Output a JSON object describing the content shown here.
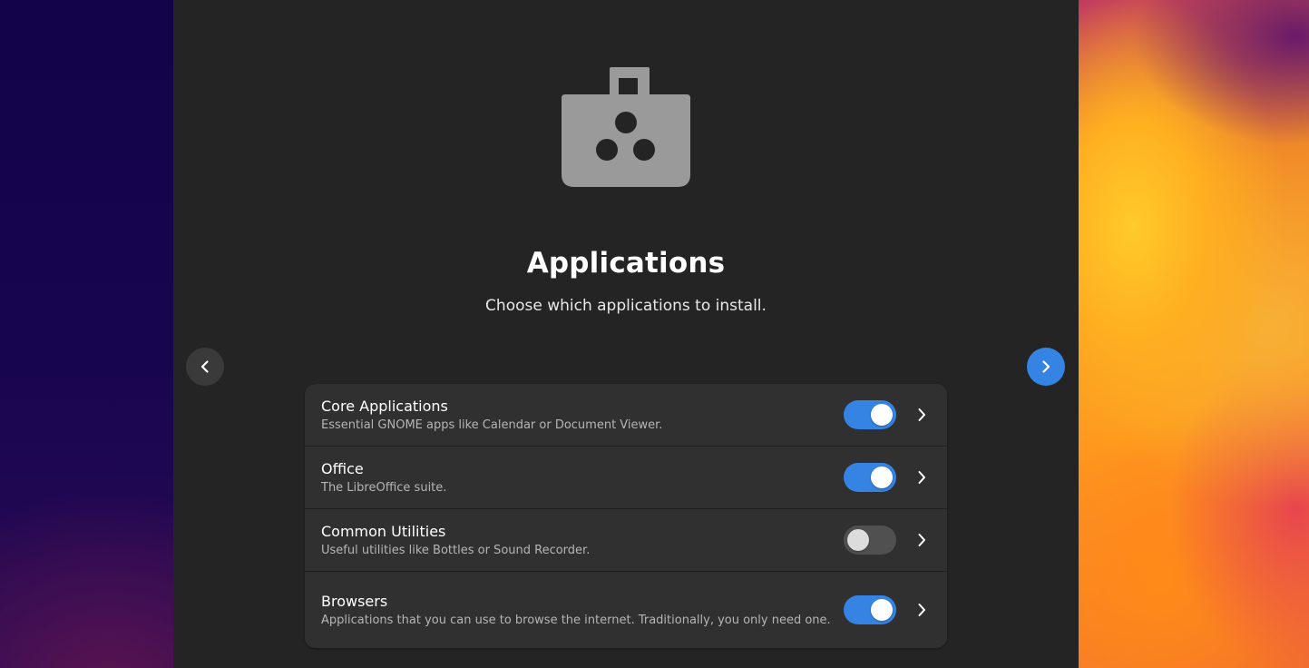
{
  "page": {
    "title": "Applications",
    "subtitle": "Choose which applications to install.",
    "icon": "software-bag-icon"
  },
  "navigation": {
    "prev_icon": "chevron-left-icon",
    "next_icon": "chevron-right-icon"
  },
  "categories": [
    {
      "title": "Core Applications",
      "description": "Essential GNOME apps like Calendar or Document Viewer.",
      "enabled": true
    },
    {
      "title": "Office",
      "description": "The LibreOffice suite.",
      "enabled": true
    },
    {
      "title": "Common Utilities",
      "description": "Useful utilities like Bottles or Sound Recorder.",
      "enabled": false
    },
    {
      "title": "Browsers",
      "description": "Applications that you can use to browse the internet. Traditionally, you only need one.",
      "enabled": true
    }
  ],
  "colors": {
    "accent": "#3584e4",
    "window_bg": "#242424",
    "row_bg": "#303030",
    "switch_off": "#505050"
  }
}
